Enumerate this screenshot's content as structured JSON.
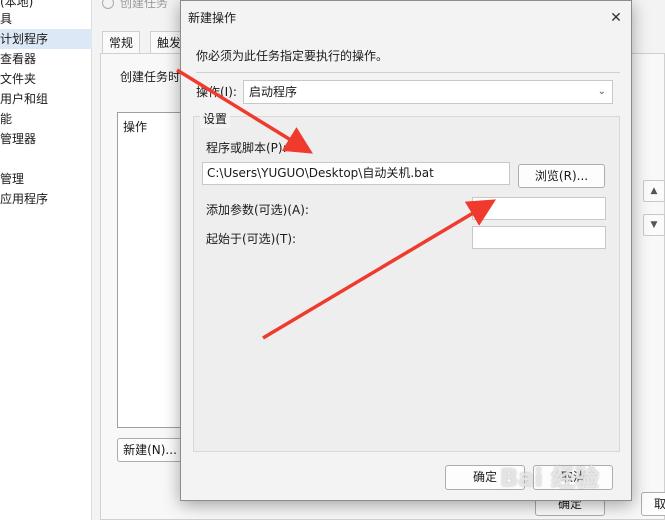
{
  "sidebar": {
    "items": [
      {
        "label": "(本地)",
        "selected": false
      },
      {
        "label": "具",
        "selected": false
      },
      {
        "label": "计划程序",
        "selected": true
      },
      {
        "label": "查看器",
        "selected": false
      },
      {
        "label": "文件夹",
        "selected": false
      },
      {
        "label": "用户和组",
        "selected": false
      },
      {
        "label": "能",
        "selected": false
      },
      {
        "label": "管理器",
        "selected": false
      },
      {
        "label": "",
        "selected": false
      },
      {
        "label": "管理",
        "selected": false
      },
      {
        "label": "应用程序",
        "selected": false
      }
    ]
  },
  "background_window": {
    "title": "创建任务",
    "tabs": [
      "常规",
      "触发"
    ],
    "label": "创建任务时",
    "list_header": "操作",
    "new_button": "新建(N)...",
    "ok_button": "确定",
    "cancel_button": "取",
    "up_glyph": "▲",
    "down_glyph": "▼"
  },
  "dialog": {
    "title": "新建操作",
    "close_glyph": "✕",
    "instruction": "你必须为此任务指定要执行的操作。",
    "action_label": "操作(I):",
    "action_value": "启动程序",
    "settings_title": "设置",
    "program_label": "程序或脚本(P):",
    "program_value": "C:\\Users\\YUGUO\\Desktop\\自动关机.bat",
    "browse_button": "浏览(R)...",
    "args_label": "添加参数(可选)(A):",
    "args_value": "",
    "start_label": "起始于(可选)(T):",
    "start_value": "",
    "ok_button": "确定",
    "cancel_button": "取消"
  },
  "watermark": "Bai 经验",
  "colors": {
    "arrow": "#f03a2e",
    "selection": "#dde8f6"
  }
}
